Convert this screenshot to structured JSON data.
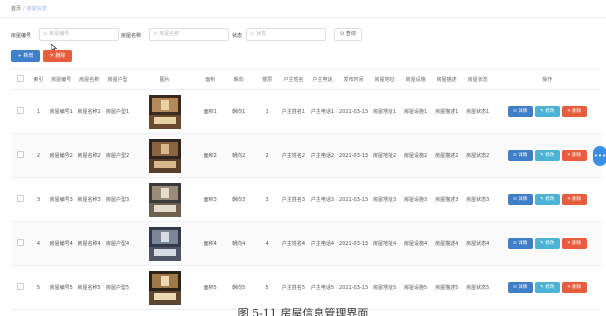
{
  "breadcrumb": {
    "home": "首页",
    "separator": "/",
    "current": "房屋信息"
  },
  "search": {
    "field1_label": "房屋编号",
    "field1_placeholder": "房屋编号",
    "field2_label": "房屋名称",
    "field2_placeholder": "房屋名称",
    "field3_label": "状态",
    "field3_placeholder": "状态",
    "query_label": "查询"
  },
  "actions": {
    "add_label": "新增",
    "delete_label": "删除"
  },
  "table": {
    "headers": [
      "索引",
      "房屋编号",
      "房屋名称",
      "房屋户型",
      "图片",
      "面积",
      "朝向",
      "楼层",
      "户主姓名",
      "户主电话",
      "发布时间",
      "房屋地址",
      "房屋设施",
      "房屋描述",
      "房屋状态",
      "操作"
    ],
    "rows": [
      {
        "index": "1",
        "code": "房屋编号1",
        "name": "房屋名称1",
        "type": "房屋户型1",
        "area": "面积1",
        "orient": "朝向1",
        "floor": "1",
        "owner": "户主姓名1",
        "phone": "户主电话1",
        "time": "2021-03-13",
        "addr": "房屋地址1",
        "facility": "房屋设施1",
        "desc": "房屋描述1",
        "status": "房屋状态1"
      },
      {
        "index": "2",
        "code": "房屋编号2",
        "name": "房屋名称2",
        "type": "房屋户型2",
        "area": "面积2",
        "orient": "朝向2",
        "floor": "2",
        "owner": "户主姓名2",
        "phone": "户主电话2",
        "time": "2021-03-13",
        "addr": "房屋地址2",
        "facility": "房屋设施2",
        "desc": "房屋描述2",
        "status": "房屋状态2"
      },
      {
        "index": "3",
        "code": "房屋编号3",
        "name": "房屋名称3",
        "type": "房屋户型3",
        "area": "面积3",
        "orient": "朝向3",
        "floor": "3",
        "owner": "户主姓名3",
        "phone": "户主电话3",
        "time": "2021-03-13",
        "addr": "房屋地址3",
        "facility": "房屋设施3",
        "desc": "房屋描述3",
        "status": "房屋状态3"
      },
      {
        "index": "4",
        "code": "房屋编号4",
        "name": "房屋名称4",
        "type": "房屋户型4",
        "area": "面积4",
        "orient": "朝向4",
        "floor": "4",
        "owner": "户主姓名4",
        "phone": "户主电话4",
        "time": "2021-03-13",
        "addr": "房屋地址4",
        "facility": "房屋设施4",
        "desc": "房屋描述4",
        "status": "房屋状态4"
      },
      {
        "index": "5",
        "code": "房屋编号5",
        "name": "房屋名称5",
        "type": "房屋户型5",
        "area": "面积5",
        "orient": "朝向5",
        "floor": "5",
        "owner": "户主姓名5",
        "phone": "户主电话5",
        "time": "2021-03-13",
        "addr": "房屋地址5",
        "facility": "房屋设施5",
        "desc": "房屋描述5",
        "status": "房屋状态5"
      }
    ],
    "op_edit": "详情",
    "op_modify": "修改",
    "op_delete": "删除"
  },
  "caption": "图 5-11 房屋信息管理界面"
}
